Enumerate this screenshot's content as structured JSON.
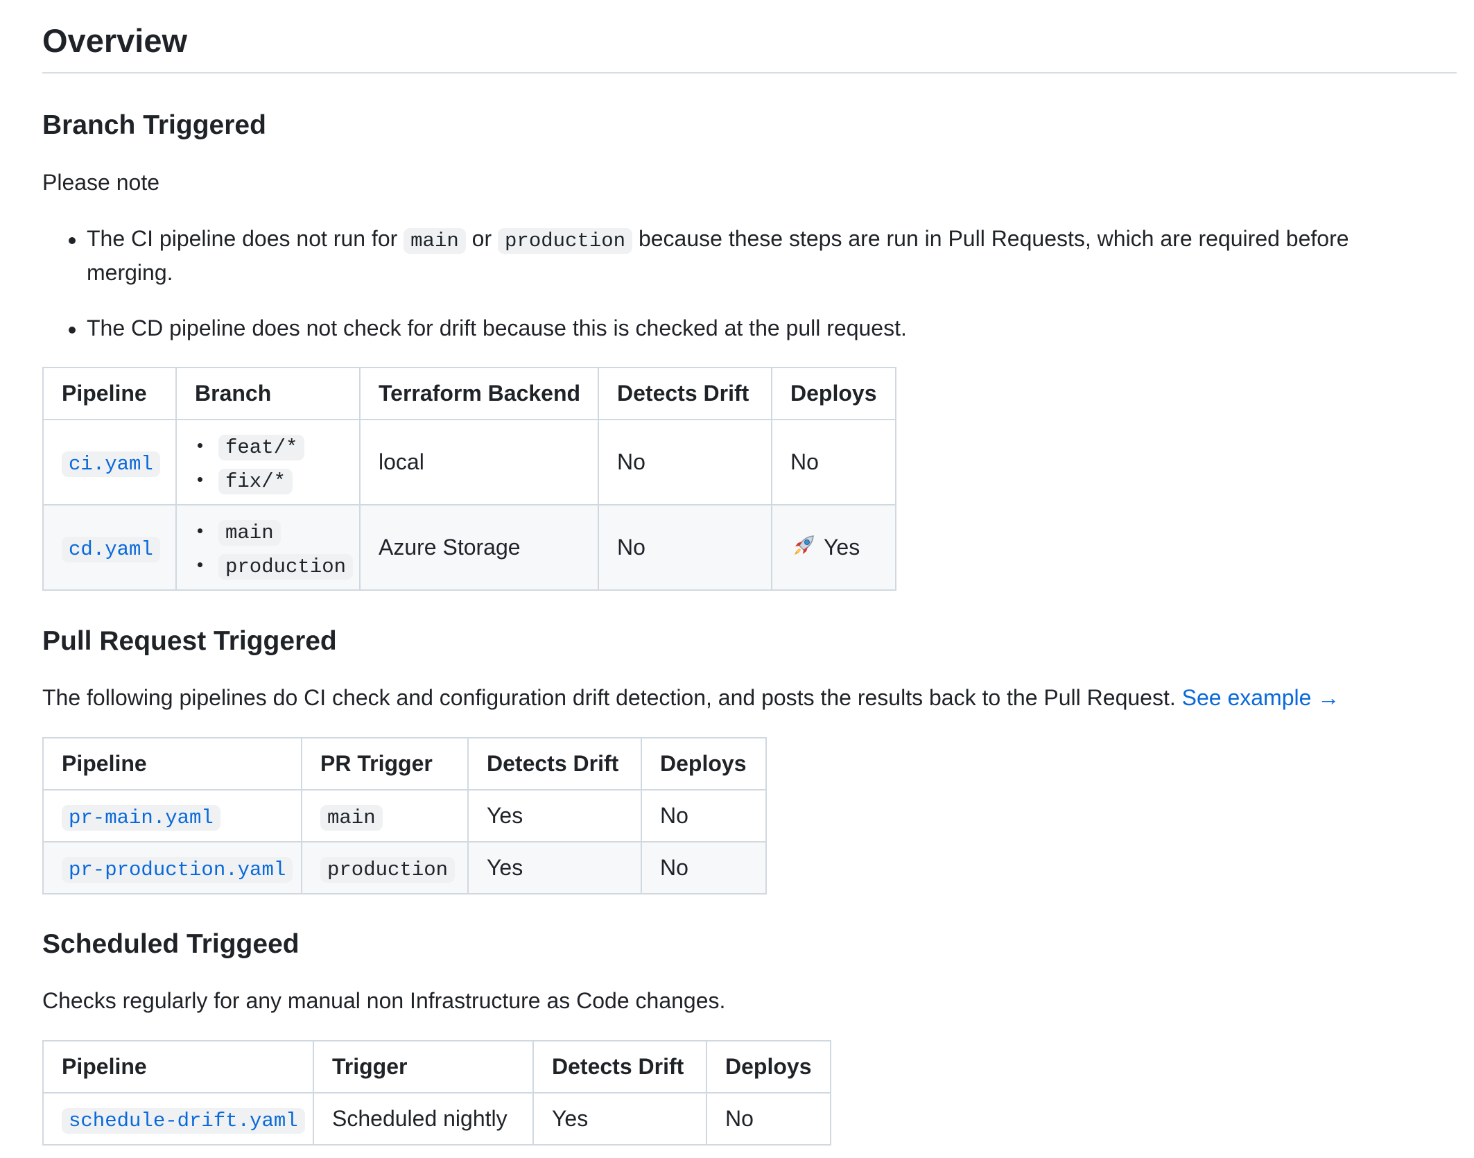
{
  "overview_title": "Overview",
  "branch": {
    "title": "Branch Triggered",
    "note": "Please note",
    "bullet1": {
      "before": "The CI pipeline does not run for",
      "code1": "main",
      "mid": "or",
      "code2": "production",
      "after": "because these steps are run in Pull Requests, which are required before",
      "wrap": "merging."
    },
    "bullet2": "The CD pipeline does not check for drift because this is checked at the pull request.",
    "table": {
      "headers": [
        "Pipeline",
        "Branch",
        "Terraform Backend",
        "Detects Drift",
        "Deploys"
      ],
      "rows": [
        {
          "pipeline": "ci.yaml",
          "branches": [
            "feat/*",
            "fix/*"
          ],
          "backend": "local",
          "drift": "No",
          "deploys": "No"
        },
        {
          "pipeline": "cd.yaml",
          "branches": [
            "main",
            "production"
          ],
          "backend": "Azure Storage",
          "drift": "No",
          "deploys": "Yes",
          "deploys_icon": "rocket-icon"
        }
      ]
    }
  },
  "pr": {
    "title": "Pull Request Triggered",
    "desc": "The following pipelines do CI check and configuration drift detection, and posts the results back to the Pull Request.",
    "link": "See example →",
    "table": {
      "headers": [
        "Pipeline",
        "PR Trigger",
        "Detects Drift",
        "Deploys"
      ],
      "rows": [
        {
          "pipeline": "pr-main.yaml",
          "trigger": "main",
          "drift": "Yes",
          "deploys": "No"
        },
        {
          "pipeline": "pr-production.yaml",
          "trigger": "production",
          "drift": "Yes",
          "deploys": "No"
        }
      ]
    }
  },
  "scheduled": {
    "title": "Scheduled Triggeed",
    "desc": "Checks regularly for any manual non Infrastructure as Code changes.",
    "table": {
      "headers": [
        "Pipeline",
        "Trigger",
        "Detects Drift",
        "Deploys"
      ],
      "rows": [
        {
          "pipeline": "schedule-drift.yaml",
          "trigger": "Scheduled nightly",
          "drift": "Yes",
          "deploys": "No"
        }
      ]
    }
  },
  "colors": {
    "text": "#1f2328",
    "link": "#0969da",
    "code_bg": "#eff1f3",
    "border": "#d1d9e0",
    "alt_row": "#f6f8fa"
  }
}
